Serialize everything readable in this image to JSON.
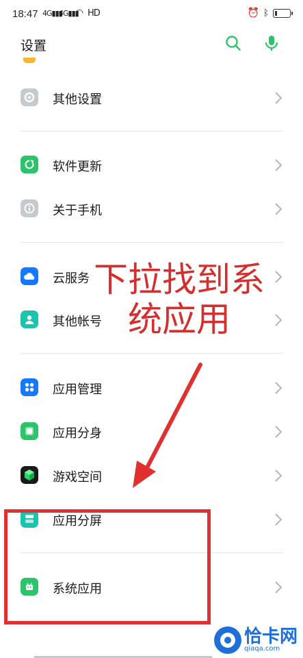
{
  "status_bar": {
    "time": "18:47",
    "sig1": "4G",
    "sig2": "4G",
    "net": "HD"
  },
  "header": {
    "title": "设置"
  },
  "settings": [
    {
      "label": "其他设置",
      "icon": "gear-icon",
      "color": "#c7c9ce"
    },
    {
      "label": "软件更新",
      "icon": "refresh-icon",
      "color": "#2cc36b"
    },
    {
      "label": "关于手机",
      "icon": "info-icon",
      "color": "#c7c9ce"
    },
    {
      "label": "云服务",
      "icon": "cloud-icon",
      "color": "#1677ff"
    },
    {
      "label": "其他帐号",
      "icon": "person-icon",
      "color": "#1cc4b0"
    },
    {
      "label": "应用管理",
      "icon": "grid-icon",
      "color": "#1677ff"
    },
    {
      "label": "应用分身",
      "icon": "clone-icon",
      "color": "#2cc36b"
    },
    {
      "label": "游戏空间",
      "icon": "cube-icon",
      "color": "#1a1a1a"
    },
    {
      "label": "应用分屏",
      "icon": "split-icon",
      "color": "#1cc4b0"
    },
    {
      "label": "系统应用",
      "icon": "android-icon",
      "color": "#2cc36b"
    }
  ],
  "annotation": {
    "line1": "下拉找到系",
    "line2": "统应用"
  },
  "watermark": {
    "text": "恰卡网",
    "sub": "qiaqa.com"
  },
  "colors": {
    "accent": "#2cc36b",
    "annotation_red": "#e03030"
  }
}
